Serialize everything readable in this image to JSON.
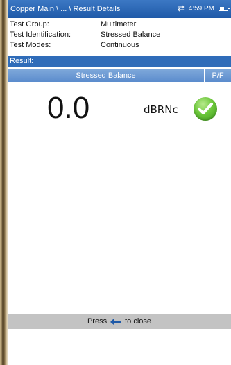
{
  "titlebar": {
    "title": "Copper Main \\ ... \\ Result Details",
    "time": "4:59 PM",
    "sync_icon": "sync-arrows-icon",
    "battery_icon": "battery-icon"
  },
  "info": [
    {
      "label": "Test Group:",
      "value": "Multimeter"
    },
    {
      "label": "Test Identification:",
      "value": "Stressed Balance"
    },
    {
      "label": "Test Modes:",
      "value": "Continuous"
    }
  ],
  "result": {
    "label": "Result:"
  },
  "table": {
    "col_test": "Stressed Balance",
    "col_pf": "P/F"
  },
  "measurement": {
    "value": "0.0",
    "unit": "dBRNc",
    "pass_icon": "check-pass-icon"
  },
  "footer": {
    "press": "Press",
    "to_close": "to close",
    "icon": "back-arrow-icon"
  },
  "colors": {
    "accent": "#2f6cb9",
    "header_light": "#6b98d3",
    "pass": "#5cbc2e",
    "footer_bg": "#c3c3c3"
  }
}
